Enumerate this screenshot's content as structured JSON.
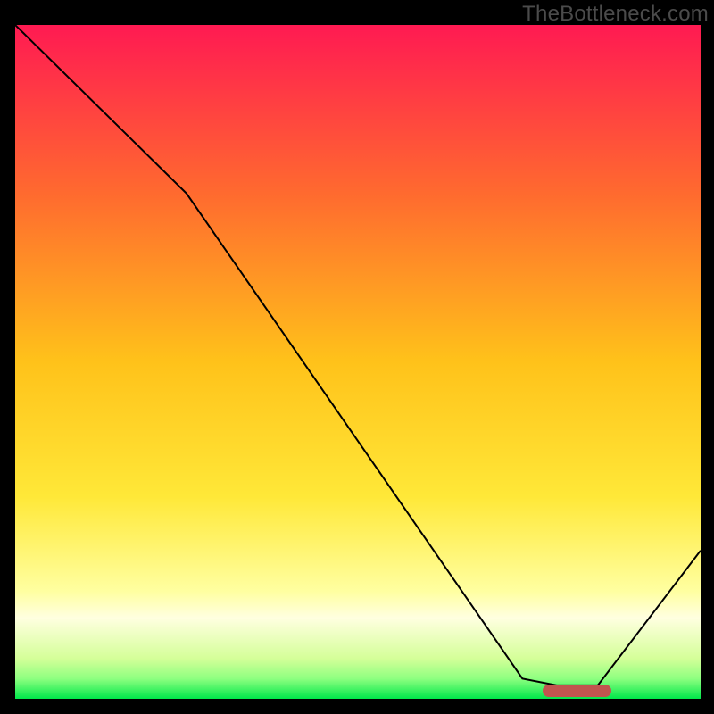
{
  "watermark": "TheBottleneck.com",
  "chart_data": {
    "type": "line",
    "title": "",
    "xlabel": "",
    "ylabel": "",
    "xlim": [
      0,
      100
    ],
    "ylim": [
      0,
      100
    ],
    "grid": false,
    "legend": false,
    "gradient_stops": [
      {
        "offset": 0,
        "color": "#ff1a52"
      },
      {
        "offset": 0.25,
        "color": "#ff6a2f"
      },
      {
        "offset": 0.5,
        "color": "#ffc21a"
      },
      {
        "offset": 0.7,
        "color": "#ffe838"
      },
      {
        "offset": 0.84,
        "color": "#ffffa0"
      },
      {
        "offset": 0.88,
        "color": "#ffffe0"
      },
      {
        "offset": 0.94,
        "color": "#d5ff99"
      },
      {
        "offset": 0.97,
        "color": "#8eff80"
      },
      {
        "offset": 1.0,
        "color": "#00e84a"
      }
    ],
    "series": [
      {
        "name": "bottleneck-curve",
        "x": [
          0,
          25,
          74,
          79,
          85,
          100
        ],
        "y": [
          100,
          75,
          3,
          2,
          2,
          22
        ]
      }
    ],
    "optimal_zone": {
      "x_start": 77,
      "x_end": 87,
      "y": 1.2
    }
  }
}
